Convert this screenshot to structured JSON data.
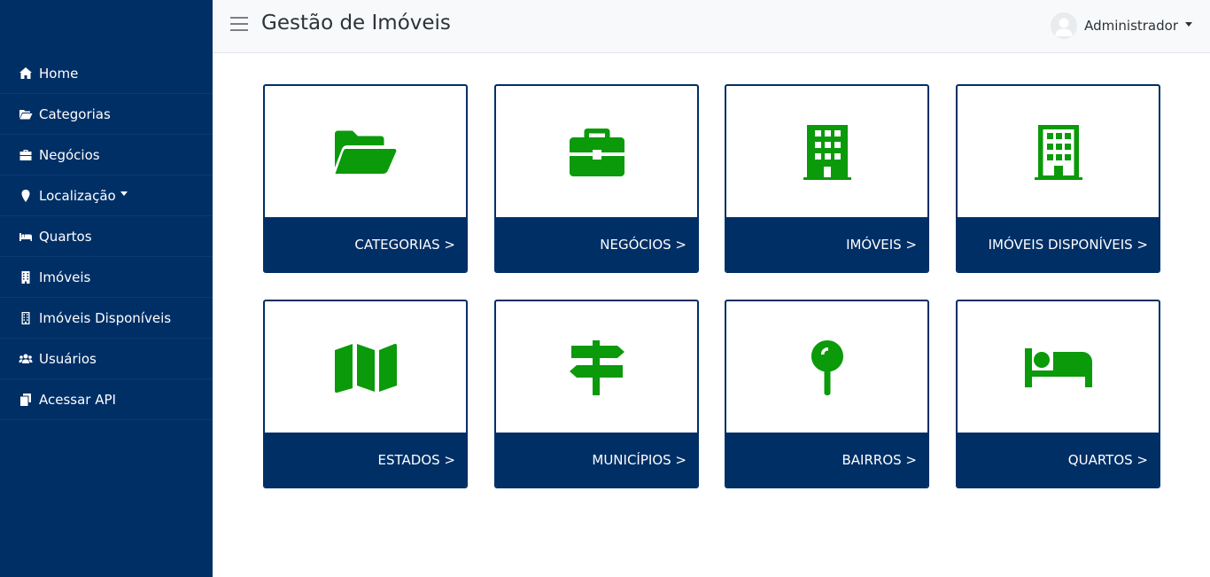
{
  "header": {
    "title": "Gestão de Imóveis",
    "user_name": "Administrador"
  },
  "sidebar": {
    "items": [
      {
        "label": "Home",
        "icon": "home-icon"
      },
      {
        "label": "Categorias",
        "icon": "folder-open-icon"
      },
      {
        "label": "Negócios",
        "icon": "briefcase-icon"
      },
      {
        "label": "Localização",
        "icon": "map-marker-icon"
      },
      {
        "label": "Quartos",
        "icon": "bed-icon"
      },
      {
        "label": "Imóveis",
        "icon": "building-icon"
      },
      {
        "label": "Imóveis Disponíveis",
        "icon": "building-outline-icon"
      },
      {
        "label": "Usuários",
        "icon": "users-icon"
      },
      {
        "label": "Acessar API",
        "icon": "copy-icon"
      }
    ]
  },
  "cards": [
    {
      "label": "CATEGORIAS >",
      "icon": "folder-open-icon"
    },
    {
      "label": "NEGÓCIOS >",
      "icon": "briefcase-icon"
    },
    {
      "label": "IMÓVEIS >",
      "icon": "building-icon"
    },
    {
      "label": "IMÓVEIS DISPONÍVEIS >",
      "icon": "building-outline-icon"
    },
    {
      "label": "ESTADOS >",
      "icon": "map-icon"
    },
    {
      "label": "MUNICÍPIOS >",
      "icon": "signpost-icon"
    },
    {
      "label": "BAIRROS >",
      "icon": "map-pin-icon"
    },
    {
      "label": "QUARTOS >",
      "icon": "bed-icon"
    }
  ],
  "colors": {
    "sidebar_bg": "#002f66",
    "card_footer_bg": "#002f66",
    "icon_green": "#0a9a0a",
    "header_bg": "#f8f9fa"
  }
}
